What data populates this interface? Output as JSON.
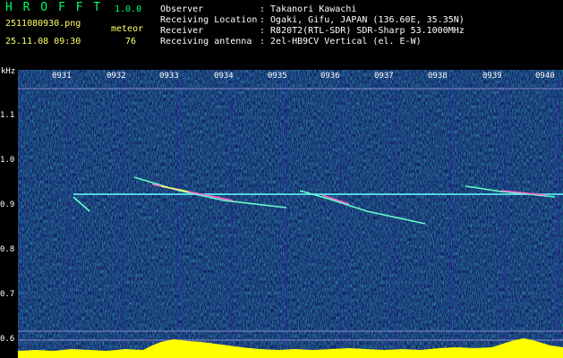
{
  "app": {
    "name": "H R O F F T",
    "version": "1.0.0"
  },
  "file": {
    "name": "2511080930.png",
    "datetime": "25.11.08 09:30"
  },
  "meteor": {
    "label": "meteor",
    "count": "76"
  },
  "station": {
    "observer_label": "Observer",
    "observer": ": Takanori Kawachi",
    "location_label": "Receiving Location",
    "location": ": Ogaki, Gifu, JAPAN (136.60E, 35.35N)",
    "receiver_label": "Receiver",
    "receiver": ": R820T2(RTL-SDR) SDR-Sharp 53.1000MHz",
    "antenna_label": "Receiving antenna",
    "antenna": ": 2el-HB9CV Vertical (el. E-W)"
  },
  "axis": {
    "unit": "kHz",
    "y_ticks": [
      "1.1",
      "1.0",
      "0.9",
      "0.8",
      "0.7",
      "0.6"
    ],
    "time_ticks": [
      "0931",
      "0932",
      "0933",
      "0934",
      "0935",
      "0936",
      "0937",
      "0938",
      "0939",
      "0940"
    ]
  },
  "colors": {
    "background": "#0a0a5a",
    "carrier": "#66ffff",
    "meteor_trace": "#ff66cc",
    "audio_level": "#ffff00",
    "label_green": "#00ff66"
  }
}
